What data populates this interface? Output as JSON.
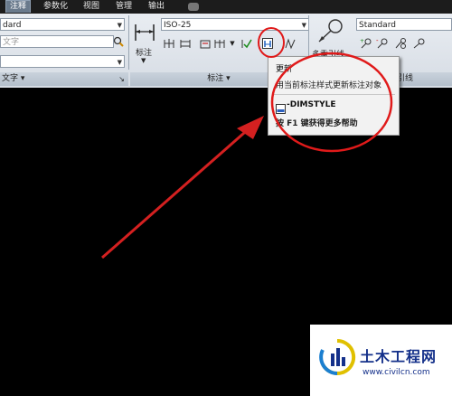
{
  "tabs": [
    {
      "label": "注释",
      "active": true
    },
    {
      "label": "参数化"
    },
    {
      "label": "视图"
    },
    {
      "label": "管理"
    },
    {
      "label": "输出"
    }
  ],
  "text_panel": {
    "style_value": "dard",
    "text_placeholder": "文字",
    "footer_label": "文字 ▾"
  },
  "dim_panel": {
    "large_button_label": "标注",
    "style_value": "ISO-25",
    "footer_label": "标注 ▾"
  },
  "leader_panel": {
    "button_label": "多重引线",
    "style_value": "Standard",
    "footer_label": "引线"
  },
  "tooltip": {
    "title": "更新",
    "description": "用当前标注样式更新标注对象",
    "command": "-DIMSTYLE",
    "hint": "按 F1 键获得更多帮助"
  },
  "watermark": {
    "title": "土木工程网",
    "url": "www.civilcn.com"
  },
  "colors": {
    "ribbon": "#dfe4ea",
    "canvas": "#000000",
    "annotation_red": "#e01a1a",
    "watermark_blue": "#14308a"
  }
}
